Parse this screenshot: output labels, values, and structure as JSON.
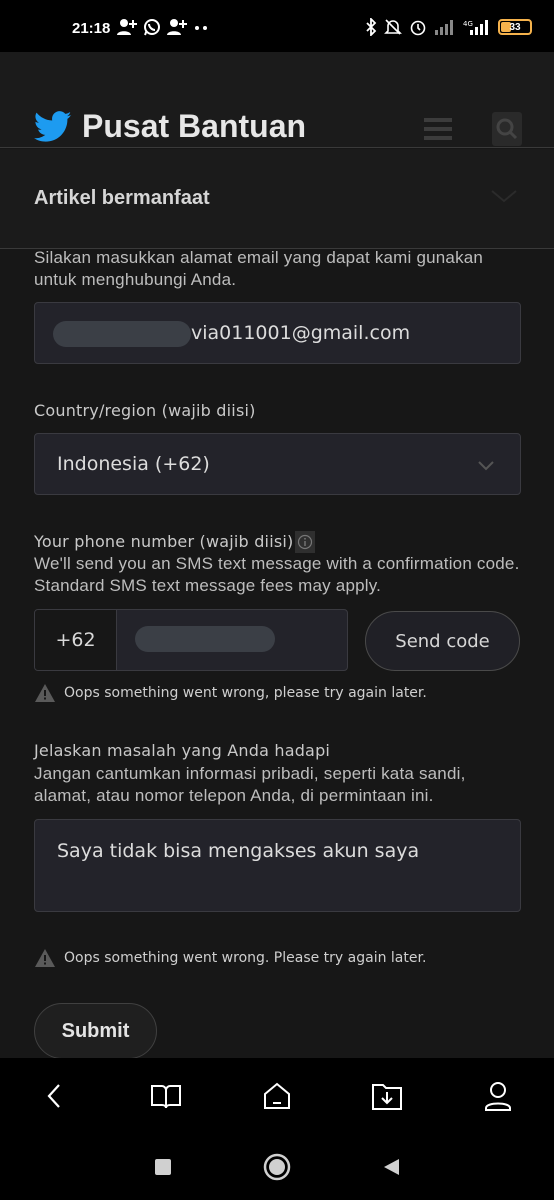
{
  "status_bar": {
    "time": "21:18",
    "left_icons": [
      "person-add-icon",
      "whatsapp-icon",
      "person-add-icon",
      "more-dots-icon"
    ],
    "right_icons": [
      "bluetooth-icon",
      "mute-icon",
      "alarm-icon",
      "signal-icon",
      "4g-signal-icon"
    ],
    "network": "4G",
    "battery": "33"
  },
  "header": {
    "title": "Pusat Bantuan",
    "logo_icon": "twitter-bird-icon",
    "menu_icon": "hamburger-icon",
    "search_icon": "search-icon"
  },
  "section": {
    "label": "Artikel bermanfaat",
    "chevron_icon": "chevron-down-icon"
  },
  "email": {
    "description": "Silakan masukkan alamat email yang dapat kami gunakan untuk menghubungi Anda.",
    "value": "via011001@gmail.com"
  },
  "country": {
    "label": "Country/region (wajib diisi)",
    "value": "Indonesia (+62)"
  },
  "phone": {
    "label": "Your phone number (wajib diisi)",
    "info_icon": "info-icon",
    "description": "We'll send you an SMS text message with a confirmation code. Standard SMS text message fees may apply.",
    "prefix": "+62",
    "send_code": "Send code",
    "error": "Oops something went wrong, please try again later."
  },
  "problem": {
    "label": "Jelaskan masalah yang Anda hadapi",
    "description": "Jangan cantumkan informasi pribadi, seperti kata sandi, alamat, atau nomor telepon Anda, di permintaan ini.",
    "value": "Saya tidak bisa mengakses akun saya"
  },
  "form_error": "Oops something went wrong. Please try again later.",
  "submit_label": "Submit",
  "browser_bar": [
    "back-icon",
    "bookmarks-icon",
    "home-icon",
    "downloads-icon",
    "profile-icon"
  ],
  "nav_bar": [
    "recents-icon",
    "home-icon",
    "back-icon"
  ],
  "colors": {
    "background": "#171717",
    "field": "#23232a",
    "twitter_blue": "#1d9bf0",
    "battery": "#f5b24c"
  }
}
